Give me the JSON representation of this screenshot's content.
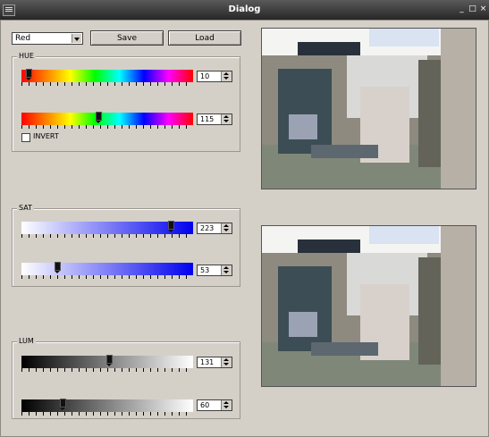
{
  "window": {
    "title": "Dialog",
    "minimize": "_",
    "maximize": "□",
    "close": "×"
  },
  "toolbar": {
    "channel_value": "Red",
    "save_label": "Save",
    "load_label": "Load"
  },
  "hue": {
    "label": "HUE",
    "min_value": "10",
    "max_value": "115",
    "min_fraction": 0.04,
    "max_fraction": 0.45,
    "invert_label": "INVERT",
    "invert_checked": false
  },
  "sat": {
    "label": "SAT",
    "min_value": "223",
    "max_value": "53",
    "min_fraction": 0.87,
    "max_fraction": 0.21
  },
  "lum": {
    "label": "LUM",
    "min_value": "131",
    "max_value": "60",
    "min_fraction": 0.51,
    "max_fraction": 0.24
  },
  "images": [
    "camera-preview-top",
    "camera-preview-bottom"
  ]
}
